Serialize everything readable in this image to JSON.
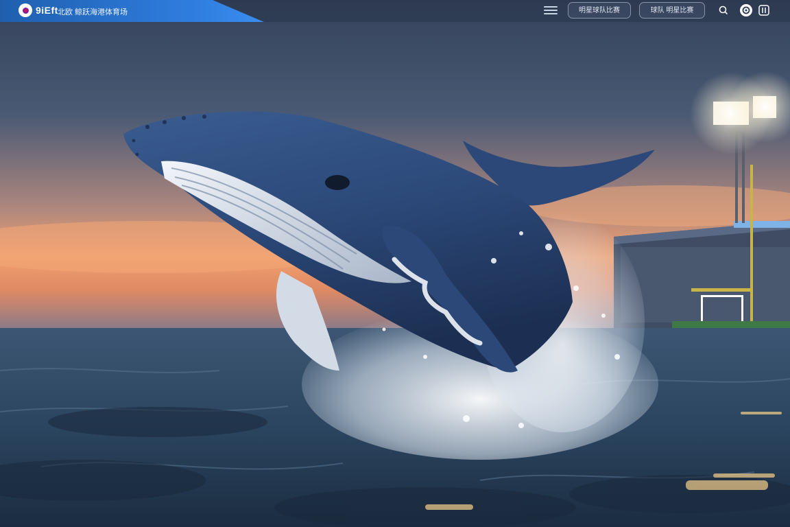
{
  "header": {
    "brand": "9iEft",
    "tagline": "北欧 鲸跃海港体育场",
    "nav_buttons": [
      "明星球队比赛",
      "球队 明星比赛"
    ]
  },
  "icons": {
    "logo": "circle-logo-icon",
    "menu": "menu-lines-icon",
    "search": "search-icon",
    "profile": "profile-circle-icon",
    "apps": "apps-grid-icon"
  },
  "colors": {
    "brand_band": "#2f7ee0",
    "sky_top": "#3a4a63",
    "sunset_orange": "#f0a070",
    "ocean": "#2b4560",
    "whale_body": "#2c4a78"
  }
}
